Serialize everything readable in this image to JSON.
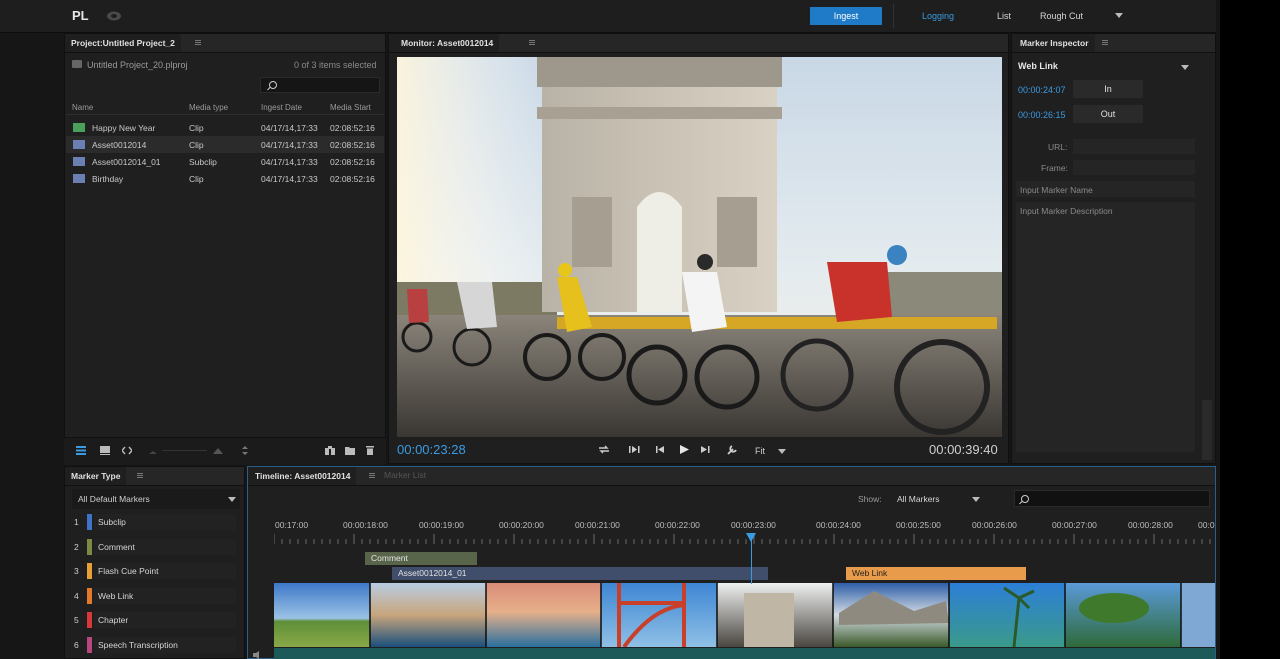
{
  "app": {
    "logo": "PL",
    "ingest_label": "Ingest",
    "logging_label": "Logging",
    "list_label": "List",
    "workspace": "Rough Cut"
  },
  "project": {
    "tab": "Project:Untitled Project_2",
    "path": "Untitled Project_20.plproj",
    "selection_count": "0 of 3 items selected",
    "columns": [
      "Name",
      "Media type",
      "Ingest Date",
      "Media Start"
    ],
    "rows": [
      {
        "name": "Happy New Year",
        "type": "Clip",
        "date": "04/17/14,17:33",
        "start": "02:08:52:16"
      },
      {
        "name": "Asset0012014",
        "type": "Clip",
        "date": "04/17/14,17:33",
        "start": "02:08:52:16"
      },
      {
        "name": "Asset0012014_01",
        "type": "Subclip",
        "date": "04/17/14,17:33",
        "start": "02:08:52:16"
      },
      {
        "name": "Birthday",
        "type": "Clip",
        "date": "04/17/14,17:33",
        "start": "02:08:52:16"
      }
    ]
  },
  "monitor": {
    "tab": "Monitor: Asset0012014",
    "current_timecode": "00:00:23:28",
    "duration_timecode": "00:00:39:40",
    "fit_label": "Fit"
  },
  "inspector": {
    "tab": "Marker Inspector",
    "marker_type": "Web Link",
    "in_timecode": "00:00:24:07",
    "in_label": "In",
    "out_timecode": "00:00:26:15",
    "out_label": "Out",
    "url_label": "URL:",
    "frame_label": "Frame:",
    "name_placeholder": "Input Marker Name",
    "description_placeholder": "Input Marker Description"
  },
  "marker_types": {
    "tab": "Marker Type",
    "filter": "All Default Markers",
    "items": [
      {
        "num": "1",
        "label": "Subclip",
        "color": "#3f73c8"
      },
      {
        "num": "2",
        "label": "Comment",
        "color": "#7a8a42"
      },
      {
        "num": "3",
        "label": "Flash Cue Point",
        "color": "#e6a035"
      },
      {
        "num": "4",
        "label": "Web Link",
        "color": "#e37a2a"
      },
      {
        "num": "5",
        "label": "Chapter",
        "color": "#d8383a"
      },
      {
        "num": "6",
        "label": "Speech Transcription",
        "color": "#b8467f"
      }
    ]
  },
  "timeline": {
    "tab": "Timeline: Asset0012014",
    "tab2": "Marker List",
    "show_label": "Show:",
    "show_value": "All Markers",
    "ruler": [
      "00:17:00",
      "00:00:18:00",
      "00:00:19:00",
      "00:00:20:00",
      "00:00:21:00",
      "00:00:22:00",
      "00:00:23:00",
      "00:00:24:00",
      "00:00:25:00",
      "00:00:26:00",
      "00:00:27:00",
      "00:00:28:00",
      "00:0"
    ],
    "markers": {
      "comment": "Comment",
      "subclip": "Asset0012014_01",
      "weblink": "Web Link"
    }
  }
}
